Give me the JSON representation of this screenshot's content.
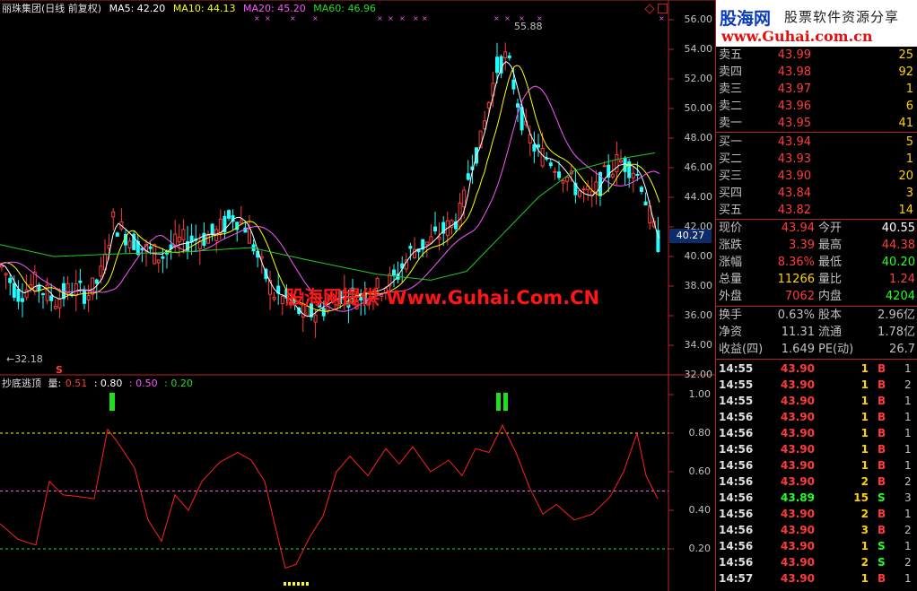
{
  "header": {
    "stock": "丽珠集团(日线 前复权)",
    "ma5": "MA5: 42.20",
    "ma10": "MA10: 44.13",
    "ma20": "MA20: 45.20",
    "ma60": "MA60: 46.96"
  },
  "indicator": {
    "name": "抄底逃顶",
    "var": "量:",
    "v1": "0.51",
    "v2": ": 0.80",
    "v3": ": 0.50",
    "v4": ": 0.20"
  },
  "price_axis": [
    "56.00",
    "54.00",
    "52.00",
    "50.00",
    "48.00",
    "46.00",
    "44.00",
    "42.00",
    "40.00",
    "38.00",
    "36.00",
    "34.00",
    "32.00"
  ],
  "indicator_axis": [
    "1.00",
    "0.80",
    "0.60",
    "0.40",
    "0.20"
  ],
  "annotations": {
    "high": "55.88",
    "low": "←32.18",
    "current_tag": "40.27",
    "s_marker": "S"
  },
  "watermark": "股海网提供 Www.Guhai.Com.CN",
  "logo": {
    "main": "股海网",
    "sub": "股票软件资源分享",
    "url": "www.Guhai.com.cn"
  },
  "order_book": {
    "asks": [
      {
        "label": "卖五",
        "price": "43.99",
        "vol": "25"
      },
      {
        "label": "卖四",
        "price": "43.98",
        "vol": "92"
      },
      {
        "label": "卖三",
        "price": "43.97",
        "vol": "1"
      },
      {
        "label": "卖二",
        "price": "43.96",
        "vol": "6"
      },
      {
        "label": "卖一",
        "price": "43.95",
        "vol": "41"
      }
    ],
    "bids": [
      {
        "label": "买一",
        "price": "43.94",
        "vol": "5"
      },
      {
        "label": "买二",
        "price": "43.93",
        "vol": "1"
      },
      {
        "label": "买三",
        "price": "43.90",
        "vol": "20"
      },
      {
        "label": "买四",
        "price": "43.84",
        "vol": "3"
      },
      {
        "label": "买五",
        "price": "43.82",
        "vol": "14"
      }
    ]
  },
  "quote": [
    {
      "l1": "现价",
      "v1": "43.94",
      "l2": "今开",
      "v2": "40.55",
      "c1": "#ff3b3b",
      "c2": "#ffffff"
    },
    {
      "l1": "涨跌",
      "v1": "3.39",
      "l2": "最高",
      "v2": "44.38",
      "c1": "#ff3b3b",
      "c2": "#ff3b3b"
    },
    {
      "l1": "涨幅",
      "v1": "8.36%",
      "l2": "最低",
      "v2": "40.20",
      "c1": "#ff3b3b",
      "c2": "#22ff22"
    },
    {
      "l1": "总量",
      "v1": "11266",
      "l2": "量比",
      "v2": "1.24",
      "c1": "#ffd200",
      "c2": "#ff3b3b"
    },
    {
      "l1": "外盘",
      "v1": "7062",
      "l2": "内盘",
      "v2": "4204",
      "c1": "#ff3b3b",
      "c2": "#22ff22"
    }
  ],
  "fundamentals": [
    {
      "l1": "换手",
      "v1": "0.63%",
      "l2": "股本",
      "v2": "2.96亿"
    },
    {
      "l1": "净资",
      "v1": "11.31",
      "l2": "流通",
      "v2": "1.78亿"
    },
    {
      "l1": "收益(四)",
      "v1": "1.649",
      "l2": "PE(动)",
      "v2": "26.7"
    }
  ],
  "ticks": [
    {
      "t": "14:55",
      "p": "43.90",
      "v": "1",
      "d": "B",
      "n": "1"
    },
    {
      "t": "14:55",
      "p": "43.90",
      "v": "1",
      "d": "B",
      "n": "2"
    },
    {
      "t": "14:55",
      "p": "43.90",
      "v": "1",
      "d": "B",
      "n": "1"
    },
    {
      "t": "14:56",
      "p": "43.90",
      "v": "1",
      "d": "B",
      "n": "1"
    },
    {
      "t": "14:56",
      "p": "43.90",
      "v": "1",
      "d": "B",
      "n": "1"
    },
    {
      "t": "14:56",
      "p": "43.90",
      "v": "1",
      "d": "B",
      "n": "1"
    },
    {
      "t": "14:56",
      "p": "43.90",
      "v": "1",
      "d": "B",
      "n": "1"
    },
    {
      "t": "14:56",
      "p": "43.90",
      "v": "2",
      "d": "B",
      "n": "2"
    },
    {
      "t": "14:56",
      "p": "43.89",
      "v": "15",
      "d": "S",
      "n": "3"
    },
    {
      "t": "14:56",
      "p": "43.90",
      "v": "2",
      "d": "B",
      "n": "1"
    },
    {
      "t": "14:56",
      "p": "43.90",
      "v": "3",
      "d": "B",
      "n": "2"
    },
    {
      "t": "14:56",
      "p": "43.90",
      "v": "1",
      "d": "S",
      "n": "1"
    },
    {
      "t": "14:56",
      "p": "43.90",
      "v": "2",
      "d": "S",
      "n": "2"
    },
    {
      "t": "14:57",
      "p": "43.90",
      "v": "1",
      "d": "B",
      "n": "1"
    }
  ],
  "colors": {
    "up": "#ff3b3b",
    "down": "#22ffff",
    "ma5": "#ffffff",
    "ma10": "#ffff00",
    "ma20": "#ff55ff",
    "ma60": "#22cc22",
    "indicator": "#ff2020"
  }
}
